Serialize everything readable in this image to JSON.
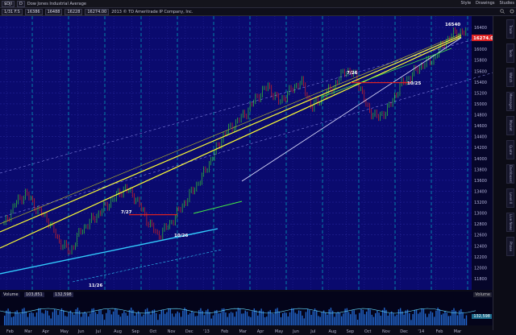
{
  "topbar": {
    "symbol": "$DJI",
    "interval": "D",
    "chart_title": "Dow Jones Industrial Average",
    "fields": [
      "1/31 F.S",
      "16386",
      "16488",
      "16228",
      "16274.00"
    ],
    "note": "2013 © TD Ameritrade IP Company, Inc.",
    "right_labels": [
      "Style",
      "Drawings",
      "Studies"
    ]
  },
  "side_tabs": [
    "Trade",
    "Tools",
    "Watch",
    "Messages",
    "Market",
    "Quote",
    "Dashboard",
    "Level II",
    "Live News",
    "Phase"
  ],
  "chart_data": {
    "type": "line",
    "price_axis": [
      "16400",
      "16200",
      "16000",
      "15800",
      "15600",
      "15400",
      "15200",
      "15000",
      "14800",
      "14600",
      "14400",
      "14200",
      "14000",
      "13800",
      "13600",
      "13400",
      "13200",
      "13000",
      "12800",
      "12600",
      "12400",
      "12200",
      "12000",
      "11800"
    ],
    "ylim": [
      11800,
      16500
    ],
    "last_price": "16274.00",
    "annotations": [
      "7/27",
      "7/26",
      "10/26",
      "10/25",
      "11/26",
      "16540"
    ],
    "months": [
      "Feb",
      "Mar",
      "Apr",
      "May",
      "Jun",
      "Jul",
      "Aug",
      "Sep",
      "Oct",
      "Nov",
      "Dec",
      "'13",
      "Feb",
      "Mar",
      "Apr",
      "May",
      "Jun",
      "Jul",
      "Aug",
      "Sep",
      "Oct",
      "Nov",
      "Dec",
      "'14",
      "Feb",
      "Mar"
    ]
  },
  "volume": {
    "label": "Volume",
    "values": [
      "103,851",
      "132,598"
    ],
    "right_value": "132,598",
    "right_label": "Volume"
  },
  "colors": {
    "background": "#0a0a6e",
    "grid": "#2a2aa0",
    "up": "#33cc33",
    "down": "#dd2222",
    "trend_yellow": "#ffff33",
    "trend_cyan": "#33ccff",
    "trend_white": "#e0e0ff",
    "vertical_cyan": "#00d0d0",
    "price_tag": "#dd2222"
  }
}
